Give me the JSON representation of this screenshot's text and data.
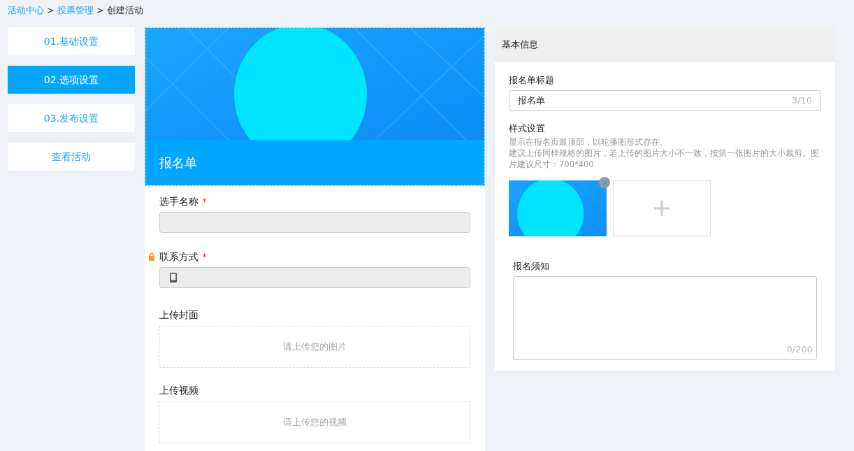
{
  "breadcrumb": [
    {
      "kind": "link",
      "text": "活动中心"
    },
    {
      "kind": "separator",
      "text": ">"
    },
    {
      "kind": "link",
      "text": "投票管理"
    },
    {
      "kind": "separator",
      "text": ">"
    },
    {
      "kind": "current",
      "text": "创建活动"
    }
  ],
  "steps": [
    {
      "label": "01.基础设置",
      "selected": false
    },
    {
      "label": "02.选项设置",
      "selected": true
    },
    {
      "label": "03.发布设置",
      "selected": false
    },
    {
      "label": "查看活动",
      "selected": false
    }
  ],
  "form": {
    "title": "报名单",
    "fields": [
      {
        "kind": "input",
        "label": "选手名称",
        "required_mark": "*",
        "locked": false
      },
      {
        "kind": "phone",
        "label": "联系方式",
        "required_mark": "*",
        "locked": true
      },
      {
        "kind": "upload",
        "label": "上传封面",
        "placeholder": "请上传您的图片"
      },
      {
        "kind": "upload",
        "label": "上传视频",
        "placeholder": "请上传您的视频"
      }
    ]
  },
  "settings": {
    "header": "基本信息",
    "title_field": {
      "label": "报名单标题",
      "value": "报名单",
      "counter": "3/10"
    },
    "style": {
      "label": "样式设置",
      "hint_lines": [
        "显示在报名页最顶部，以轮播图形式存在。",
        "建议上传同样规格的图片，若上传的图片大小不一致，按第一张图片的大小裁剪。图片建议尺寸：700*400"
      ]
    },
    "notice": {
      "label": "报名须知",
      "counter": "0/200"
    }
  }
}
